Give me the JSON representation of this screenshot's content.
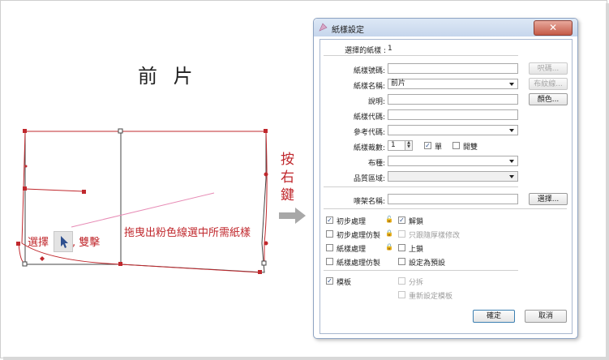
{
  "canvas": {
    "title": "前 片",
    "instruction_drag": "拖曳出粉色線選中所需紙樣",
    "instruction_select_prefix": "選擇",
    "instruction_select_suffix": ", 雙擊",
    "right_click_vertical": [
      "按",
      "右",
      "鍵"
    ]
  },
  "dialog": {
    "title": "紙樣設定",
    "close_symbol": "✕",
    "selected_count_label": "選擇的紙樣 :",
    "selected_count_value": "1",
    "fields": {
      "pattern_no_label": "紙樣號碼:",
      "pattern_no_value": "",
      "pattern_name_label": "紙樣名稱:",
      "pattern_name_value": "前片",
      "description_label": "說明:",
      "description_value": "",
      "pattern_code_label": "紙樣代碼:",
      "pattern_code_value": "",
      "reference_code_label": "參考代碼:",
      "reference_code_value": "",
      "pieces_label": "紙樣裁數:",
      "pieces_value": "1",
      "single_label": "單",
      "single_checked": true,
      "pair_label": "開雙",
      "pair_checked": false,
      "fabric_label": "布種:",
      "fabric_value": "",
      "quality_zone_label": "品質區域:",
      "quality_zone_value": "",
      "style_name_label": "嘜架名稱:",
      "style_name_value": ""
    },
    "buttons": {
      "lookup": "呎碼...",
      "layout_lines": "布紋線...",
      "color": "顏色...",
      "select": "選擇...",
      "ok": "確定",
      "cancel": "取消"
    },
    "options": {
      "initial_processing": {
        "label": "初步處理",
        "checked": true
      },
      "unlock": {
        "label": "解鎖",
        "checked": true
      },
      "initial_processing_copy": {
        "label": "初步處理仿製",
        "checked": false
      },
      "follow_thickness": {
        "label": "只跟隨厚樣修改",
        "checked": false
      },
      "pattern_processing": {
        "label": "紙樣處理",
        "checked": false
      },
      "lock": {
        "label": "上鎖",
        "checked": false
      },
      "pattern_processing_copy": {
        "label": "紙樣處理仿製",
        "checked": false
      },
      "set_default": {
        "label": "設定為預設",
        "checked": false
      },
      "template": {
        "label": "模板",
        "checked": true
      },
      "split": {
        "label": "分拆",
        "checked": false
      },
      "reset_template": {
        "label": "重新設定模板",
        "checked": false
      }
    }
  }
}
